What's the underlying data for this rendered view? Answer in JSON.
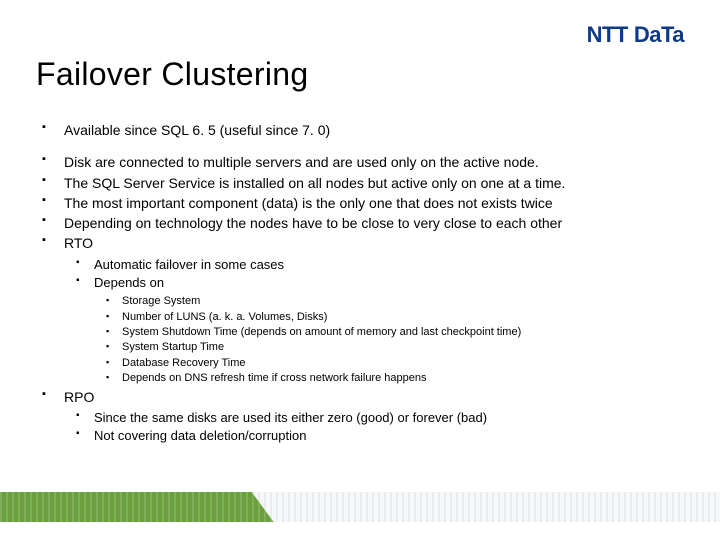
{
  "logo": {
    "text": "NTT DaTa"
  },
  "title": "Failover Clustering",
  "bullets": [
    "Available since SQL 6. 5 (useful since 7. 0)",
    "Disk are connected to multiple servers and are used only on the active node.",
    "The SQL Server Service is installed on all nodes but active only on one at a time.",
    "The most important component (data) is the only one that does not exists twice",
    "Depending on technology the nodes have to be close to very close to each other",
    "RTO",
    "RPO"
  ],
  "rto_sub": [
    "Automatic failover in some cases",
    "Depends on"
  ],
  "rto_depends_on": [
    "Storage System",
    "Number of LUNS (a. k. a. Volumes, Disks)",
    "System Shutdown Time (depends on amount of memory and last checkpoint time)",
    "System Startup Time",
    "Database Recovery Time",
    "Depends on DNS refresh time if cross network failure happens"
  ],
  "rpo_sub": [
    "Since the same disks are used its either zero (good) or forever (bad)",
    "Not covering data deletion/corruption"
  ]
}
